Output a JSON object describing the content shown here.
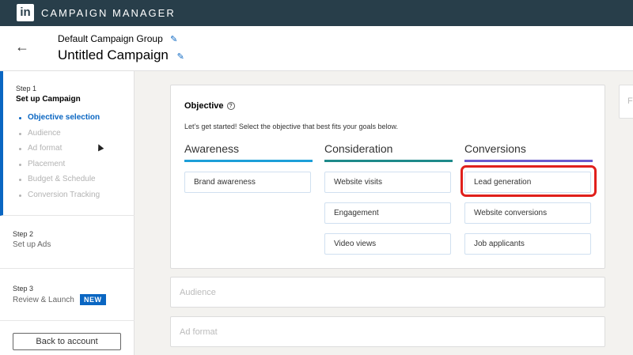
{
  "app": {
    "logo": "in",
    "title": "CAMPAIGN MANAGER"
  },
  "header": {
    "group_name": "Default Campaign Group",
    "campaign_name": "Untitled Campaign",
    "back_icon": "arrow-left-icon",
    "edit_icon": "pencil-icon"
  },
  "sidebar": {
    "step1": {
      "label": "Step 1",
      "title": "Set up Campaign",
      "items": [
        {
          "label": "Objective selection",
          "active": true
        },
        {
          "label": "Audience"
        },
        {
          "label": "Ad format"
        },
        {
          "label": "Placement"
        },
        {
          "label": "Budget & Schedule"
        },
        {
          "label": "Conversion Tracking"
        }
      ]
    },
    "step2": {
      "label": "Step 2",
      "title": "Set up Ads"
    },
    "step3": {
      "label": "Step 3",
      "title": "Review & Launch",
      "badge": "NEW"
    },
    "back_button": "Back to account"
  },
  "objective": {
    "title": "Objective",
    "help_icon": "?",
    "intro": "Let’s get started! Select the objective that best fits your goals below.",
    "columns": [
      {
        "name": "Awareness",
        "color": "#1d9fd8",
        "options": [
          "Brand awareness"
        ]
      },
      {
        "name": "Consideration",
        "color": "#1e8a8a",
        "options": [
          "Website visits",
          "Engagement",
          "Video views"
        ]
      },
      {
        "name": "Conversions",
        "color": "#6a5acd",
        "options": [
          "Lead generation",
          "Website conversions",
          "Job applicants"
        ]
      }
    ],
    "highlighted_option": "Lead generation",
    "highlight_color": "#e0201c"
  },
  "sections": {
    "audience": "Audience",
    "ad_format": "Ad format"
  },
  "right_panel": {
    "letter": "F"
  },
  "colors": {
    "topbar": "#283e4a",
    "accent": "#0a66c2"
  }
}
